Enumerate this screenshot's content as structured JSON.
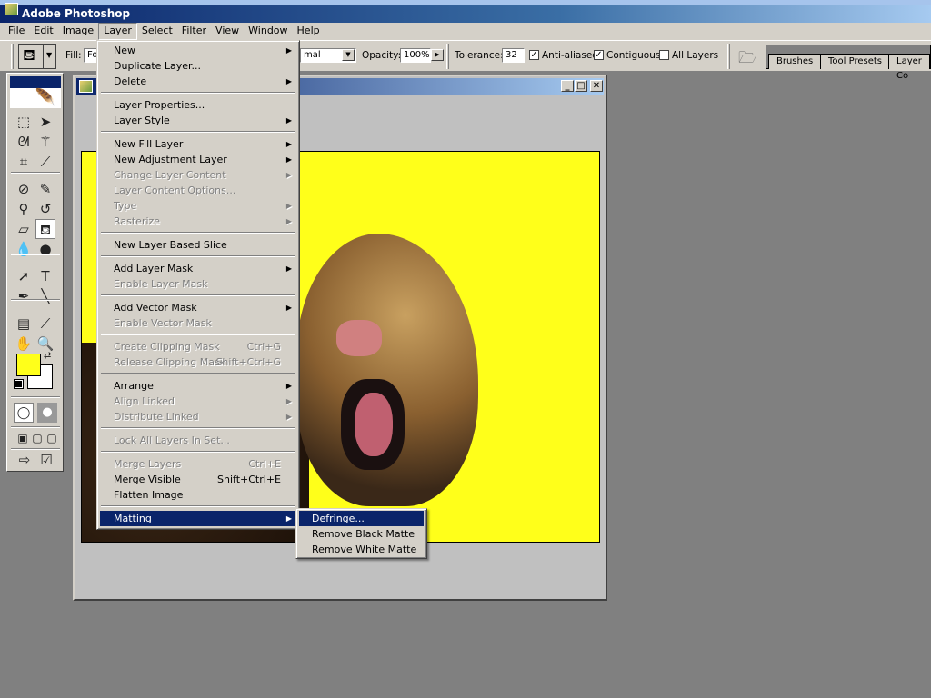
{
  "app": {
    "title": "Adobe Photoshop"
  },
  "menubar": [
    "File",
    "Edit",
    "Image",
    "Layer",
    "Select",
    "Filter",
    "View",
    "Window",
    "Help"
  ],
  "options": {
    "fill_label": "Fill:",
    "fill_value": "Fo",
    "mode_value": "mal",
    "opacity_label": "Opacity:",
    "opacity_value": "100%",
    "tolerance_label": "Tolerance:",
    "tolerance_value": "32",
    "anti_aliased": "Anti-aliased",
    "anti_aliased_checked": true,
    "contiguous": "Contiguous",
    "contiguous_checked": true,
    "all_layers": "All Layers",
    "all_layers_checked": false
  },
  "palette_tabs": [
    "Brushes",
    "Tool Presets",
    "Layer Co"
  ],
  "colors": {
    "foreground": "#ffff1a",
    "background": "#ffffff",
    "highlight": "#0a246a"
  },
  "layer_menu": [
    {
      "label": "New",
      "submenu": true
    },
    {
      "label": "Duplicate Layer..."
    },
    {
      "label": "Delete",
      "submenu": true
    },
    {
      "sep": true
    },
    {
      "label": "Layer Properties..."
    },
    {
      "label": "Layer Style",
      "submenu": true
    },
    {
      "sep": true
    },
    {
      "label": "New Fill Layer",
      "submenu": true
    },
    {
      "label": "New Adjustment Layer",
      "submenu": true
    },
    {
      "label": "Change Layer Content",
      "submenu": true,
      "disabled": true
    },
    {
      "label": "Layer Content Options...",
      "disabled": true
    },
    {
      "label": "Type",
      "submenu": true,
      "disabled": true
    },
    {
      "label": "Rasterize",
      "submenu": true,
      "disabled": true
    },
    {
      "sep": true
    },
    {
      "label": "New Layer Based Slice"
    },
    {
      "sep": true
    },
    {
      "label": "Add Layer Mask",
      "submenu": true
    },
    {
      "label": "Enable Layer Mask",
      "disabled": true
    },
    {
      "sep": true
    },
    {
      "label": "Add Vector Mask",
      "submenu": true
    },
    {
      "label": "Enable Vector Mask",
      "disabled": true
    },
    {
      "sep": true
    },
    {
      "label": "Create Clipping Mask",
      "shortcut": "Ctrl+G",
      "disabled": true
    },
    {
      "label": "Release Clipping Mask",
      "shortcut": "Shift+Ctrl+G",
      "disabled": true
    },
    {
      "sep": true
    },
    {
      "label": "Arrange",
      "submenu": true
    },
    {
      "label": "Align Linked",
      "submenu": true,
      "disabled": true
    },
    {
      "label": "Distribute Linked",
      "submenu": true,
      "disabled": true
    },
    {
      "sep": true
    },
    {
      "label": "Lock All Layers In Set...",
      "disabled": true
    },
    {
      "sep": true
    },
    {
      "label": "Merge Layers",
      "shortcut": "Ctrl+E",
      "disabled": true
    },
    {
      "label": "Merge Visible",
      "shortcut": "Shift+Ctrl+E"
    },
    {
      "label": "Flatten Image"
    },
    {
      "sep": true
    },
    {
      "label": "Matting",
      "submenu": true,
      "highlighted": true
    }
  ],
  "matting_submenu": [
    {
      "label": "Defringe...",
      "highlighted": true
    },
    {
      "label": "Remove Black Matte"
    },
    {
      "label": "Remove White Matte"
    }
  ],
  "tools": [
    [
      "marquee-tool-icon",
      "⬚"
    ],
    [
      "move-tool-icon",
      "➤"
    ],
    [
      "lasso-tool-icon",
      "ᘛ"
    ],
    [
      "magic-wand-tool-icon",
      "⚚"
    ],
    [
      "crop-tool-icon",
      "⌗"
    ],
    [
      "slice-tool-icon",
      "⟋"
    ],
    [
      "healing-brush-tool-icon",
      "⊘"
    ],
    [
      "pencil-tool-icon",
      "✎"
    ],
    [
      "clone-stamp-tool-icon",
      "⚲"
    ],
    [
      "history-brush-tool-icon",
      "↺"
    ],
    [
      "eraser-tool-icon",
      "▱"
    ],
    [
      "paint-bucket-tool-icon",
      "⛾"
    ],
    [
      "blur-tool-icon",
      "💧"
    ],
    [
      "dodge-tool-icon",
      "●"
    ],
    [
      "path-selection-tool-icon",
      "➚"
    ],
    [
      "type-tool-icon",
      "T"
    ],
    [
      "pen-tool-icon",
      "✒"
    ],
    [
      "line-tool-icon",
      "╲"
    ],
    [
      "notes-tool-icon",
      "▤"
    ],
    [
      "eyedropper-tool-icon",
      "⟋"
    ],
    [
      "hand-tool-icon",
      "✋"
    ],
    [
      "zoom-tool-icon",
      "🔍"
    ]
  ]
}
